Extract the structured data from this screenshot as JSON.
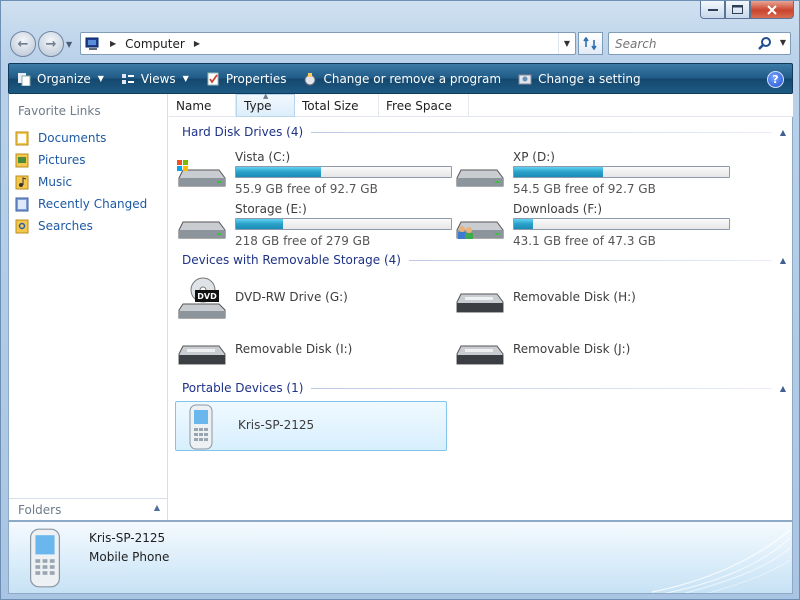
{
  "window": {
    "caption_buttons": {
      "minimize": "▭",
      "maximize": "□",
      "close": "✕"
    }
  },
  "nav": {
    "back_icon": "←",
    "forward_icon": "→",
    "breadcrumb": [
      "Computer"
    ],
    "search_placeholder": "Search"
  },
  "toolbar": {
    "items": [
      {
        "label": "Organize",
        "icon": "organize-icon",
        "has_caret": true
      },
      {
        "label": "Views",
        "icon": "views-icon",
        "has_caret": true
      },
      {
        "label": "Properties",
        "icon": "properties-icon",
        "has_caret": false
      },
      {
        "label": "Change or remove a program",
        "icon": "programs-icon",
        "has_caret": false
      },
      {
        "label": "Change a setting",
        "icon": "settings-icon",
        "has_caret": false
      }
    ],
    "help": "?"
  },
  "sidebar": {
    "title": "Favorite Links",
    "items": [
      {
        "label": "Documents",
        "icon": "documents-icon"
      },
      {
        "label": "Pictures",
        "icon": "pictures-icon"
      },
      {
        "label": "Music",
        "icon": "music-icon"
      },
      {
        "label": "Recently Changed",
        "icon": "recently-changed-icon"
      },
      {
        "label": "Searches",
        "icon": "searches-icon"
      }
    ],
    "folders_label": "Folders"
  },
  "columns": [
    "Name",
    "Type",
    "Total Size",
    "Free Space"
  ],
  "groups": {
    "hdd": {
      "title": "Hard Disk Drives (4)",
      "drives": [
        {
          "name": "Vista (C:)",
          "free_text": "55.9 GB free of 92.7 GB",
          "used_fraction": 0.397
        },
        {
          "name": "XP (D:)",
          "free_text": "54.5 GB free of 92.7 GB",
          "used_fraction": 0.412
        },
        {
          "name": "Storage (E:)",
          "free_text": "218 GB free of 279 GB",
          "used_fraction": 0.219
        },
        {
          "name": "Downloads (F:)",
          "free_text": "43.1 GB free of 47.3 GB",
          "used_fraction": 0.089
        }
      ]
    },
    "removable": {
      "title": "Devices with Removable Storage (4)",
      "devices": [
        {
          "name": "DVD-RW Drive (G:)"
        },
        {
          "name": "Removable Disk (H:)"
        },
        {
          "name": "Removable Disk (I:)"
        },
        {
          "name": "Removable Disk (J:)"
        }
      ]
    },
    "portable": {
      "title": "Portable Devices (1)",
      "devices": [
        {
          "name": "Kris-SP-2125"
        }
      ]
    }
  },
  "details": {
    "name": "Kris-SP-2125",
    "type": "Mobile Phone"
  },
  "colors": {
    "toolbar": "#1f5a86",
    "link": "#1d5aa5",
    "group_header": "#1e3287",
    "bar_fill": "#2a9fc8"
  }
}
